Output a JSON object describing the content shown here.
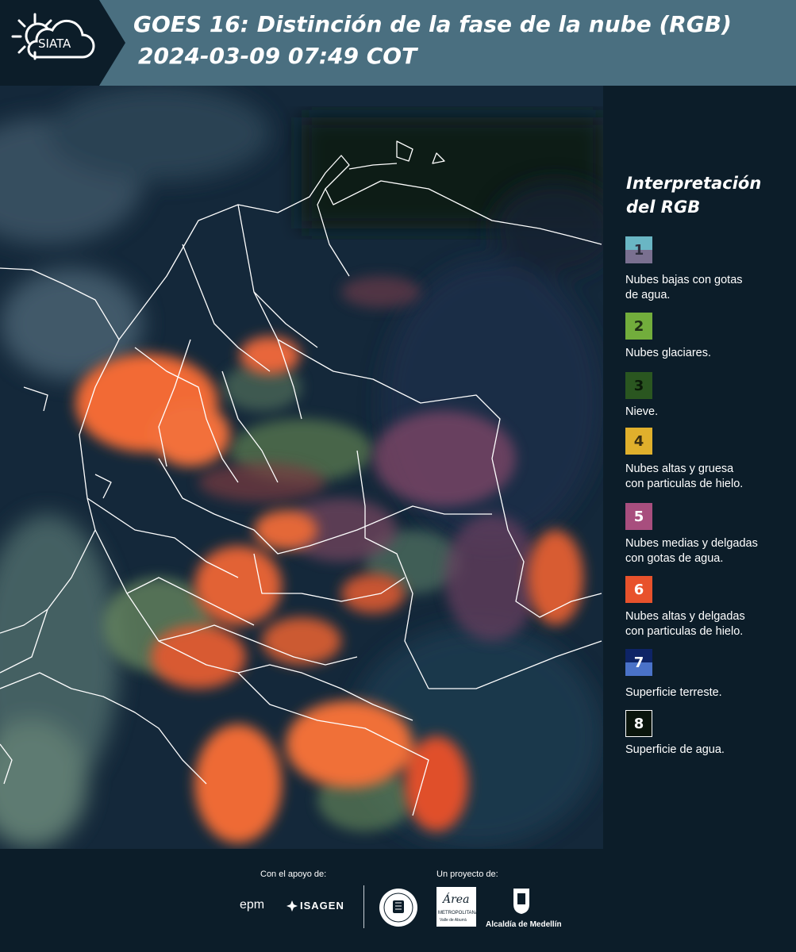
{
  "header": {
    "logo_text": "SIATA",
    "title": "GOES 16: Distinción de la fase de la nube (RGB)",
    "timestamp": "2024-03-09 07:49 COT"
  },
  "legend": {
    "title_line1": "Interpretación",
    "title_line2": "del RGB",
    "items": [
      {
        "num": "1",
        "label_line1": "Nubes bajas con gotas",
        "label_line2": "de agua.",
        "color": "#6ab6c4",
        "color2": "#7a7090"
      },
      {
        "num": "2",
        "label_line1": "Nubes glaciares.",
        "label_line2": "",
        "color": "#72ad3c"
      },
      {
        "num": "3",
        "label_line1": "Nieve.",
        "label_line2": "",
        "color": "#2a5620"
      },
      {
        "num": "4",
        "label_line1": "Nubes altas y gruesa",
        "label_line2": "con particulas de hielo.",
        "color": "#e0b02c"
      },
      {
        "num": "5",
        "label_line1": "Nubes medias y delgadas",
        "label_line2": "con gotas de agua.",
        "color": "#a84e7e"
      },
      {
        "num": "6",
        "label_line1": "Nubes altas y delgadas",
        "label_line2": "con particulas de hielo.",
        "color": "#e8522c"
      },
      {
        "num": "7",
        "label_line1": "Superficie terreste.",
        "label_line2": "",
        "color": "#0e2466",
        "color2": "#4a72c8"
      },
      {
        "num": "8",
        "label_line1": "Superficie de agua.",
        "label_line2": "",
        "color": "#0a150c"
      }
    ]
  },
  "footer": {
    "support_label": "Con el apoyo de:",
    "support_logos": [
      "epm",
      "ISAGEN"
    ],
    "project_label": "Un proyecto de:",
    "area_logo_main": "Área",
    "area_logo_line1": "METROPOLITANA",
    "area_logo_line2": "Valle de Aburrá",
    "alcaldia_label": "Alcaldía de Medellín"
  }
}
